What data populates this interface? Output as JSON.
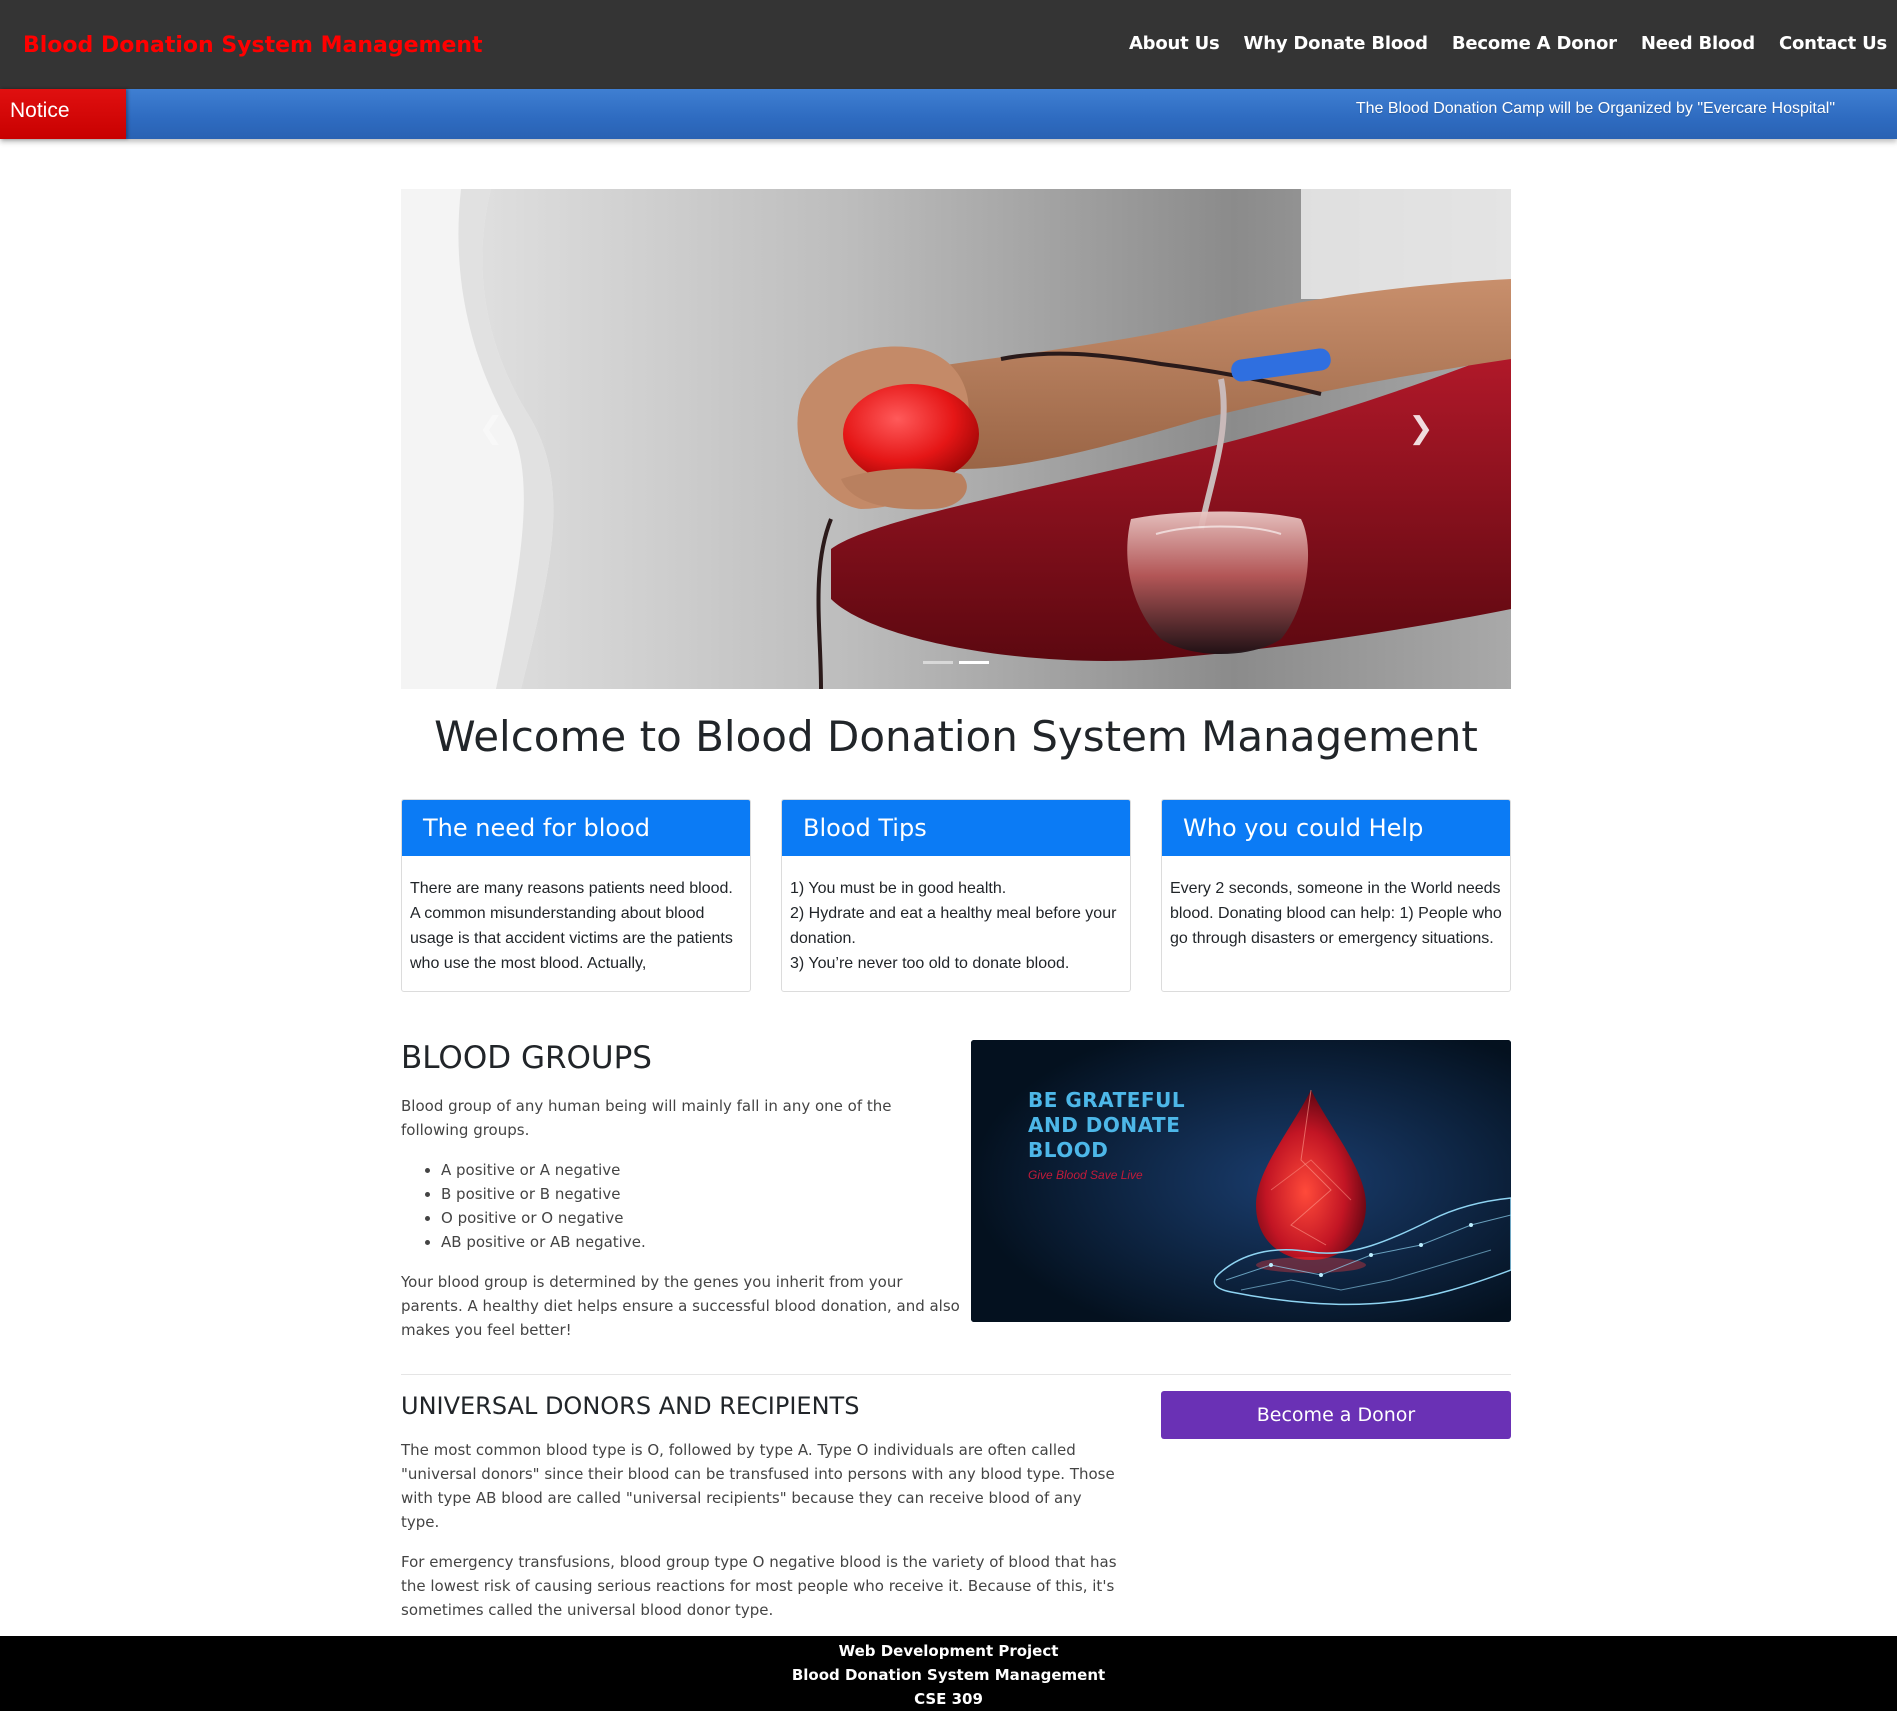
{
  "navbar": {
    "brand": "Blood Donation System Management",
    "links": [
      "About Us",
      "Why Donate Blood",
      "Become A Donor",
      "Need Blood",
      "Contact Us"
    ]
  },
  "notice": {
    "label": "Notice",
    "text": "The Blood Donation Camp will be Organized by \"Evercare Hospital\""
  },
  "carousel": {
    "prev_icon": "chevron-left-icon",
    "next_icon": "chevron-right-icon",
    "slide_count": 2,
    "active_slide": 2
  },
  "welcome": "Welcome to Blood Donation System Management",
  "cards": [
    {
      "title": "The need for blood",
      "body": [
        "There are many reasons patients need blood. A common misunderstanding about blood usage is that accident victims are the patients who use the most blood. Actually,"
      ]
    },
    {
      "title": "Blood Tips",
      "body": [
        "1) You must be in good health.",
        "2) Hydrate and eat a healthy meal before your donation.",
        "3) You’re never too old to donate blood."
      ]
    },
    {
      "title": "Who you could Help",
      "body": [
        "Every 2 seconds, someone in the World needs blood. Donating blood can help: 1) People who go through disasters or emergency situations."
      ]
    }
  ],
  "blood_groups": {
    "title": "BLOOD GROUPS",
    "intro": "Blood group of any human being will mainly fall in any one of the following groups.",
    "items": [
      "A positive or A negative",
      "B positive or B negative",
      "O positive or O negative",
      "AB positive or AB negative."
    ],
    "outro": "Your blood group is determined by the genes you inherit from your parents. A healthy diet helps ensure a successful blood donation, and also makes you feel better!"
  },
  "donate_image": {
    "line1": "BE GRATEFUL",
    "line2": "AND DONATE",
    "line3": "BLOOD",
    "sub": "Give Blood  Save Live"
  },
  "universal": {
    "title": "UNIVERSAL DONORS AND RECIPIENTS",
    "p1": "The most common blood type is O, followed by type A. Type O individuals are often called \"universal donors\" since their blood can be transfused into persons with any blood type. Those with type AB blood are called \"universal recipients\" because they can receive blood of any type.",
    "p2": "For emergency transfusions, blood group type O negative blood is the variety of blood that has the lowest risk of causing serious reactions for most people who receive it. Because of this, it's sometimes called the universal blood donor type."
  },
  "donor_button": "Become a Donor",
  "footer": {
    "line1": "Web Development Project",
    "line2": "Blood Donation System Management",
    "line3": "CSE 309"
  },
  "colors": {
    "brand": "#ff0000",
    "navbar_bg": "#343434",
    "notice_bar": "#2e6bc0",
    "notice_label": "#c80000",
    "card_header": "#0b7bf5",
    "donor_button": "#6a31b5"
  }
}
